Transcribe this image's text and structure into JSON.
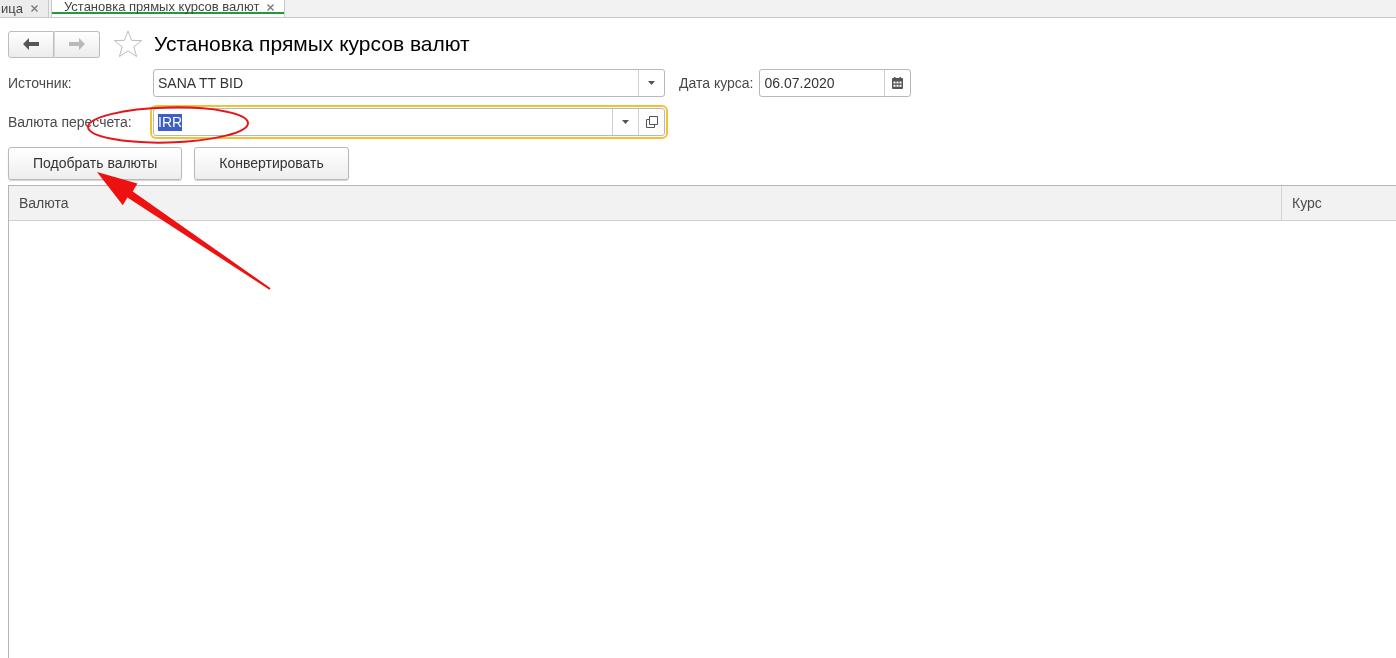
{
  "tabs": [
    {
      "label": "ица",
      "selected": false
    },
    {
      "label": "Установка прямых курсов валют",
      "selected": true
    }
  ],
  "header": {
    "back_enabled": true,
    "forward_enabled": false,
    "favorite": false,
    "title": "Установка прямых курсов валют"
  },
  "form": {
    "rows": [
      [
        {
          "kind": "select",
          "label": "Источник:",
          "value": "SANA TT BID",
          "focused": false,
          "value_selected": false
        },
        {
          "kind": "date",
          "label": "Дата курса:",
          "value": "06.07.2020",
          "focused": false,
          "value_selected": false
        }
      ],
      [
        {
          "kind": "reference",
          "label": "Валюта пересчета:",
          "value": "IRR",
          "focused": true,
          "value_selected": true
        }
      ]
    ]
  },
  "buttons": [
    {
      "label": "Подобрать валюты"
    },
    {
      "label": "Конвертировать"
    }
  ],
  "table": {
    "columns": [
      {
        "label": "Валюта"
      },
      {
        "label": "Курс"
      }
    ]
  },
  "annotations": [
    {
      "kind": "ellipse"
    },
    {
      "kind": "arrow"
    }
  ]
}
